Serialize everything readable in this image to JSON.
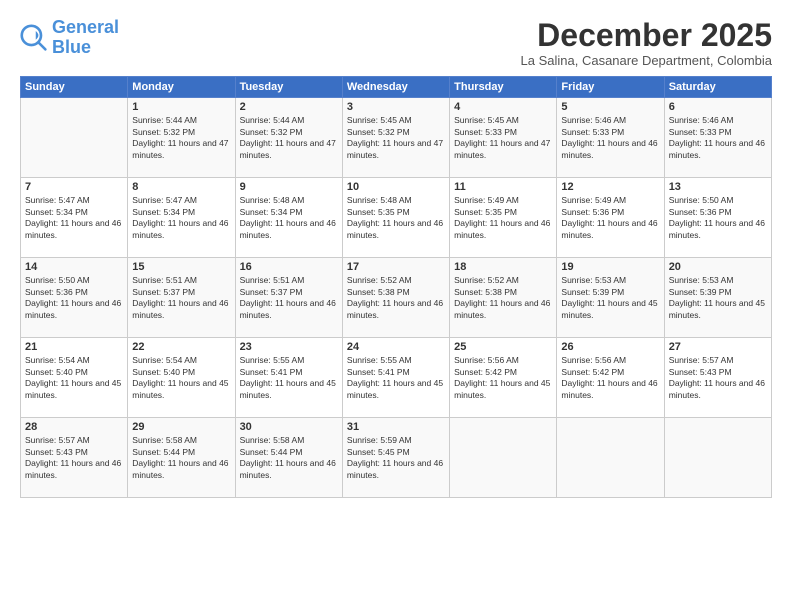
{
  "header": {
    "logo_line1": "General",
    "logo_line2": "Blue",
    "month_title": "December 2025",
    "subtitle": "La Salina, Casanare Department, Colombia"
  },
  "days_of_week": [
    "Sunday",
    "Monday",
    "Tuesday",
    "Wednesday",
    "Thursday",
    "Friday",
    "Saturday"
  ],
  "weeks": [
    [
      {
        "day": "",
        "sunrise": "",
        "sunset": "",
        "daylight": ""
      },
      {
        "day": "1",
        "sunrise": "Sunrise: 5:44 AM",
        "sunset": "Sunset: 5:32 PM",
        "daylight": "Daylight: 11 hours and 47 minutes."
      },
      {
        "day": "2",
        "sunrise": "Sunrise: 5:44 AM",
        "sunset": "Sunset: 5:32 PM",
        "daylight": "Daylight: 11 hours and 47 minutes."
      },
      {
        "day": "3",
        "sunrise": "Sunrise: 5:45 AM",
        "sunset": "Sunset: 5:32 PM",
        "daylight": "Daylight: 11 hours and 47 minutes."
      },
      {
        "day": "4",
        "sunrise": "Sunrise: 5:45 AM",
        "sunset": "Sunset: 5:33 PM",
        "daylight": "Daylight: 11 hours and 47 minutes."
      },
      {
        "day": "5",
        "sunrise": "Sunrise: 5:46 AM",
        "sunset": "Sunset: 5:33 PM",
        "daylight": "Daylight: 11 hours and 46 minutes."
      },
      {
        "day": "6",
        "sunrise": "Sunrise: 5:46 AM",
        "sunset": "Sunset: 5:33 PM",
        "daylight": "Daylight: 11 hours and 46 minutes."
      }
    ],
    [
      {
        "day": "7",
        "sunrise": "Sunrise: 5:47 AM",
        "sunset": "Sunset: 5:34 PM",
        "daylight": "Daylight: 11 hours and 46 minutes."
      },
      {
        "day": "8",
        "sunrise": "Sunrise: 5:47 AM",
        "sunset": "Sunset: 5:34 PM",
        "daylight": "Daylight: 11 hours and 46 minutes."
      },
      {
        "day": "9",
        "sunrise": "Sunrise: 5:48 AM",
        "sunset": "Sunset: 5:34 PM",
        "daylight": "Daylight: 11 hours and 46 minutes."
      },
      {
        "day": "10",
        "sunrise": "Sunrise: 5:48 AM",
        "sunset": "Sunset: 5:35 PM",
        "daylight": "Daylight: 11 hours and 46 minutes."
      },
      {
        "day": "11",
        "sunrise": "Sunrise: 5:49 AM",
        "sunset": "Sunset: 5:35 PM",
        "daylight": "Daylight: 11 hours and 46 minutes."
      },
      {
        "day": "12",
        "sunrise": "Sunrise: 5:49 AM",
        "sunset": "Sunset: 5:36 PM",
        "daylight": "Daylight: 11 hours and 46 minutes."
      },
      {
        "day": "13",
        "sunrise": "Sunrise: 5:50 AM",
        "sunset": "Sunset: 5:36 PM",
        "daylight": "Daylight: 11 hours and 46 minutes."
      }
    ],
    [
      {
        "day": "14",
        "sunrise": "Sunrise: 5:50 AM",
        "sunset": "Sunset: 5:36 PM",
        "daylight": "Daylight: 11 hours and 46 minutes."
      },
      {
        "day": "15",
        "sunrise": "Sunrise: 5:51 AM",
        "sunset": "Sunset: 5:37 PM",
        "daylight": "Daylight: 11 hours and 46 minutes."
      },
      {
        "day": "16",
        "sunrise": "Sunrise: 5:51 AM",
        "sunset": "Sunset: 5:37 PM",
        "daylight": "Daylight: 11 hours and 46 minutes."
      },
      {
        "day": "17",
        "sunrise": "Sunrise: 5:52 AM",
        "sunset": "Sunset: 5:38 PM",
        "daylight": "Daylight: 11 hours and 46 minutes."
      },
      {
        "day": "18",
        "sunrise": "Sunrise: 5:52 AM",
        "sunset": "Sunset: 5:38 PM",
        "daylight": "Daylight: 11 hours and 46 minutes."
      },
      {
        "day": "19",
        "sunrise": "Sunrise: 5:53 AM",
        "sunset": "Sunset: 5:39 PM",
        "daylight": "Daylight: 11 hours and 45 minutes."
      },
      {
        "day": "20",
        "sunrise": "Sunrise: 5:53 AM",
        "sunset": "Sunset: 5:39 PM",
        "daylight": "Daylight: 11 hours and 45 minutes."
      }
    ],
    [
      {
        "day": "21",
        "sunrise": "Sunrise: 5:54 AM",
        "sunset": "Sunset: 5:40 PM",
        "daylight": "Daylight: 11 hours and 45 minutes."
      },
      {
        "day": "22",
        "sunrise": "Sunrise: 5:54 AM",
        "sunset": "Sunset: 5:40 PM",
        "daylight": "Daylight: 11 hours and 45 minutes."
      },
      {
        "day": "23",
        "sunrise": "Sunrise: 5:55 AM",
        "sunset": "Sunset: 5:41 PM",
        "daylight": "Daylight: 11 hours and 45 minutes."
      },
      {
        "day": "24",
        "sunrise": "Sunrise: 5:55 AM",
        "sunset": "Sunset: 5:41 PM",
        "daylight": "Daylight: 11 hours and 45 minutes."
      },
      {
        "day": "25",
        "sunrise": "Sunrise: 5:56 AM",
        "sunset": "Sunset: 5:42 PM",
        "daylight": "Daylight: 11 hours and 45 minutes."
      },
      {
        "day": "26",
        "sunrise": "Sunrise: 5:56 AM",
        "sunset": "Sunset: 5:42 PM",
        "daylight": "Daylight: 11 hours and 46 minutes."
      },
      {
        "day": "27",
        "sunrise": "Sunrise: 5:57 AM",
        "sunset": "Sunset: 5:43 PM",
        "daylight": "Daylight: 11 hours and 46 minutes."
      }
    ],
    [
      {
        "day": "28",
        "sunrise": "Sunrise: 5:57 AM",
        "sunset": "Sunset: 5:43 PM",
        "daylight": "Daylight: 11 hours and 46 minutes."
      },
      {
        "day": "29",
        "sunrise": "Sunrise: 5:58 AM",
        "sunset": "Sunset: 5:44 PM",
        "daylight": "Daylight: 11 hours and 46 minutes."
      },
      {
        "day": "30",
        "sunrise": "Sunrise: 5:58 AM",
        "sunset": "Sunset: 5:44 PM",
        "daylight": "Daylight: 11 hours and 46 minutes."
      },
      {
        "day": "31",
        "sunrise": "Sunrise: 5:59 AM",
        "sunset": "Sunset: 5:45 PM",
        "daylight": "Daylight: 11 hours and 46 minutes."
      },
      {
        "day": "",
        "sunrise": "",
        "sunset": "",
        "daylight": ""
      },
      {
        "day": "",
        "sunrise": "",
        "sunset": "",
        "daylight": ""
      },
      {
        "day": "",
        "sunrise": "",
        "sunset": "",
        "daylight": ""
      }
    ]
  ]
}
